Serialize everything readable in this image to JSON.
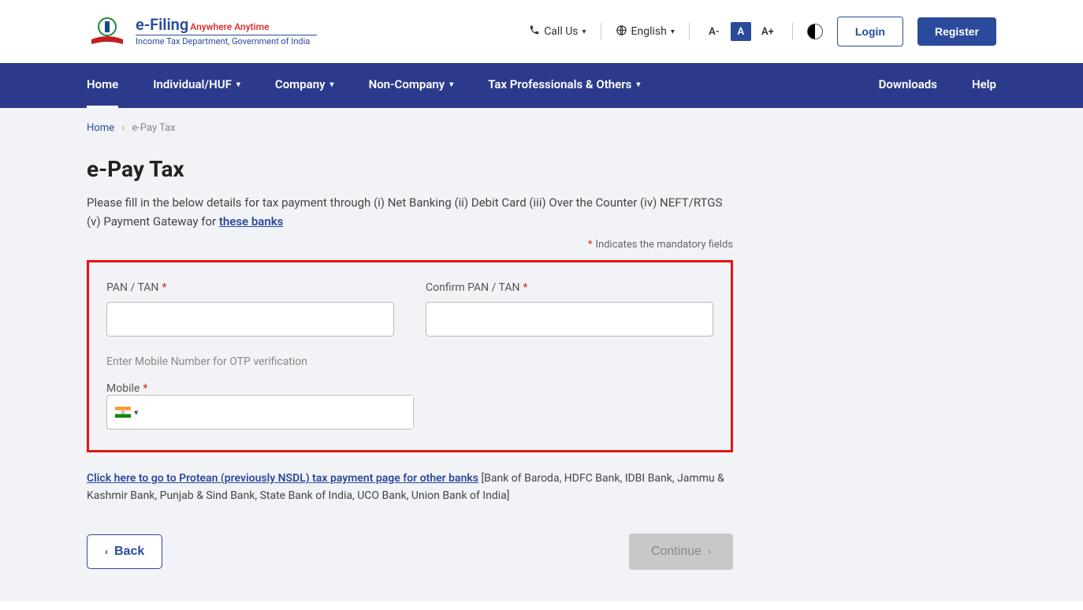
{
  "header": {
    "brand_main": "e-Filing",
    "brand_tag": "Anywhere Anytime",
    "brand_sub": "Income Tax Department, Government of India",
    "call_us": "Call Us",
    "language": "English",
    "font_small": "A-",
    "font_normal": "A",
    "font_large": "A+",
    "login": "Login",
    "register": "Register"
  },
  "nav": {
    "home": "Home",
    "individual": "Individual/HUF",
    "company": "Company",
    "noncompany": "Non-Company",
    "taxpro": "Tax Professionals & Others",
    "downloads": "Downloads",
    "help": "Help"
  },
  "breadcrumb": {
    "home": "Home",
    "current": "e-Pay Tax"
  },
  "page": {
    "title": "e-Pay Tax",
    "desc_before_link": "Please fill in the below details for tax payment through (i) Net Banking (ii) Debit Card (iii) Over the Counter (iv) NEFT/RTGS (v) Payment Gateway for ",
    "desc_link": "these banks",
    "mandatory": "Indicates the mandatory fields"
  },
  "form": {
    "pan_label": "PAN / TAN",
    "confirm_pan_label": "Confirm PAN / TAN",
    "mobile_hint": "Enter Mobile Number for OTP verification",
    "mobile_label": "Mobile",
    "pan_value": "",
    "confirm_pan_value": "",
    "mobile_value": ""
  },
  "protean": {
    "link": "Click here to go to Protean (previously NSDL) tax payment page for other banks",
    "rest": " [Bank of Baroda, HDFC Bank, IDBI Bank, Jammu & Kashmir Bank, Punjab & Sind Bank, State Bank of India, UCO Bank, Union Bank of India]"
  },
  "actions": {
    "back": "Back",
    "continue": "Continue"
  }
}
